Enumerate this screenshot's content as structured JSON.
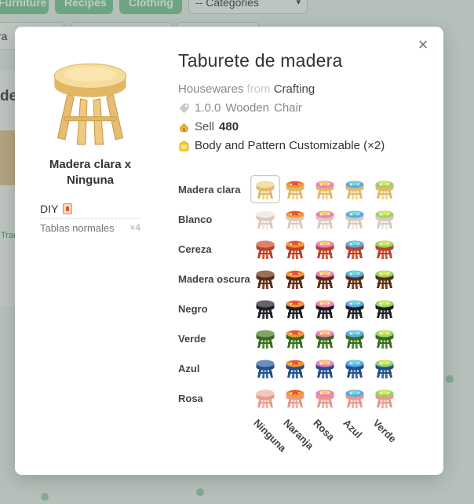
{
  "background": {
    "nav_pills": [
      "Furniture",
      "Recipes",
      "Clothing"
    ],
    "category_select": "-- Categories",
    "tab_label": "ra",
    "card_title": "de",
    "card_note": "Trad"
  },
  "modal": {
    "close_glyph": "×",
    "title": "Taburete de madera",
    "category": "Housewares",
    "from_word": "from",
    "source": "Crafting",
    "version": "1.0.0",
    "tag1": "Wooden",
    "tag2": "Chair",
    "sell_label": "Sell",
    "sell_price": "480",
    "customizable": "Body and Pattern Customizable (×2)",
    "selected_variant": "Madera clara x Ninguna",
    "diy_label": "DIY",
    "materials": [
      {
        "name": "Tablas normales",
        "qty": "×4"
      }
    ]
  },
  "variants": {
    "body_rows": [
      {
        "label": "Madera clara",
        "color": "#f3d38a",
        "leg": "#e2b86a"
      },
      {
        "label": "Blanco",
        "color": "#efe6dc",
        "leg": "#d9c9b8"
      },
      {
        "label": "Cereza",
        "color": "#d8573a",
        "leg": "#b8432b"
      },
      {
        "label": "Madera oscura",
        "color": "#7a3f22",
        "leg": "#5c2d16"
      },
      {
        "label": "Negro",
        "color": "#2f3036",
        "leg": "#1f2024"
      },
      {
        "label": "Verde",
        "color": "#4f8a2c",
        "leg": "#3a6b1f"
      },
      {
        "label": "Azul",
        "color": "#3569a8",
        "leg": "#244f84"
      },
      {
        "label": "Rosa",
        "color": "#f2b3a6",
        "leg": "#e49a8b"
      }
    ],
    "pattern_cols": [
      {
        "label": "Ninguna",
        "seat": null,
        "seat2": null
      },
      {
        "label": "Naranja",
        "seat": "#f39a2c",
        "seat2": "#e9453b"
      },
      {
        "label": "Rosa",
        "seat": "#f07bc4",
        "seat2": "#ffd35a"
      },
      {
        "label": "Azul",
        "seat": "#5aa7ef",
        "seat2": "#7ee0c8"
      },
      {
        "label": "Verde",
        "seat": "#8fd86a",
        "seat2": "#f2e35a"
      }
    ],
    "selected": {
      "row": 0,
      "col": 0
    }
  }
}
